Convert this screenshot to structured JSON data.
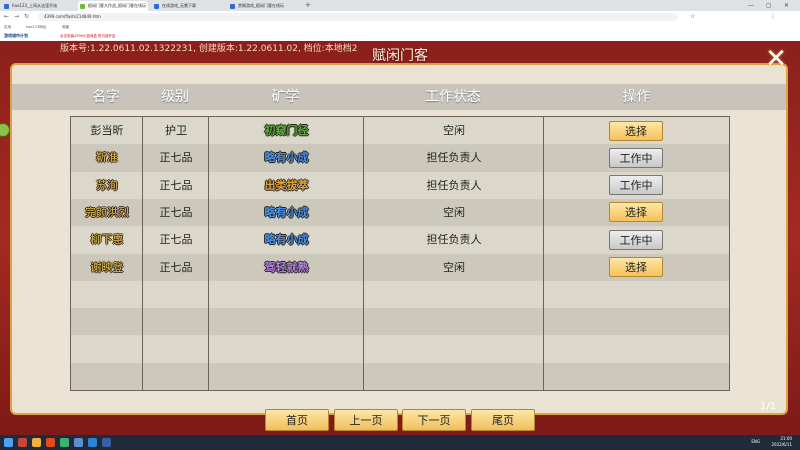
{
  "browser": {
    "tabs": [
      {
        "label": "hao123_上网从这里开始",
        "active": false
      },
      {
        "label": "赋闲门客大作战_赋闲门客在线玩",
        "active": true
      },
      {
        "label": "在线游戏_无需下载",
        "active": false
      },
      {
        "label": "赏赐游戏_赋闲门客在线玩",
        "active": false
      }
    ],
    "new_tab": "+",
    "window_controls": [
      "—",
      "▢",
      "✕"
    ],
    "url": "4399.com/flash/214849.htm",
    "bookmarks": [
      "应用",
      "hao123网址",
      "收藏"
    ],
    "site_logo": "游戏城市计划",
    "site_notice": "点击安装4399小游戏盒 防沉迷开启"
  },
  "game": {
    "version_text": "版本号:1.22.0611.02.1322231, 创建版本:1.22.0611.02, 档位:本地档2",
    "title": "赋闲门客",
    "close_label": "✕",
    "columns": [
      "名字",
      "级别",
      "矿学",
      "工作状态",
      "操作"
    ],
    "rows": [
      {
        "name": "彭当昕",
        "level": "护卫",
        "skill": "初窥门径",
        "status": "空闲",
        "action": "选择",
        "action_type": "select",
        "name_style": "plain",
        "skill_color": "#5fae3b"
      },
      {
        "name": "靳准",
        "level": "正七品",
        "skill": "略有小成",
        "status": "担任负责人",
        "action": "工作中",
        "action_type": "working",
        "name_style": "gold",
        "skill_color": "#4a90e2"
      },
      {
        "name": "苏洵",
        "level": "正七品",
        "skill": "出类拔萃",
        "status": "担任负责人",
        "action": "工作中",
        "action_type": "working",
        "name_style": "gold",
        "skill_color": "#e0a43a"
      },
      {
        "name": "完颜洪烈",
        "level": "正七品",
        "skill": "略有小成",
        "status": "空闲",
        "action": "选择",
        "action_type": "select",
        "name_style": "gold",
        "skill_color": "#4a90e2"
      },
      {
        "name": "柳下惠",
        "level": "正七品",
        "skill": "略有小成",
        "status": "担任负责人",
        "action": "工作中",
        "action_type": "working",
        "name_style": "gold",
        "skill_color": "#4a90e2"
      },
      {
        "name": "谢映登",
        "level": "正七品",
        "skill": "驾轻就熟",
        "status": "空闲",
        "action": "选择",
        "action_type": "select",
        "name_style": "gold",
        "skill_color": "#b07fd8"
      }
    ],
    "empty_rows": 4,
    "pager": {
      "first": "首页",
      "prev": "上一页",
      "next": "下一页",
      "last": "尾页"
    },
    "page_count": "1/1"
  },
  "taskbar": {
    "time": "21:00",
    "date": "2022/6/11",
    "ime": "ENG"
  },
  "colors": {
    "frame": "#a32a22",
    "gold_border": "#d9a441",
    "select_button": "#f5c15a",
    "working_button": "#c8c8c8"
  }
}
